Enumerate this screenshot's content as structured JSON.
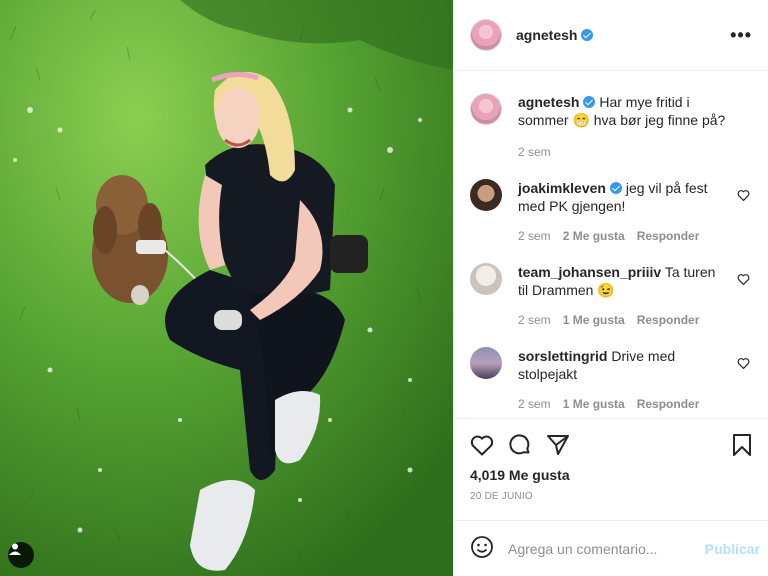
{
  "post": {
    "author": "agnetesh",
    "caption": "Har mye fritid i sommer 😁 hva bør jeg finne på?",
    "caption_time": "2 sem",
    "likes": "4,019 Me gusta",
    "date": "20 DE JUNIO"
  },
  "header": {
    "username": "agnetesh",
    "more_label": "•••"
  },
  "comments": [
    {
      "user": "joakimkleven",
      "verified": true,
      "text": "jeg vil på fest med PK gjengen!",
      "time": "2 sem",
      "likes": "2 Me gusta",
      "reply": "Responder"
    },
    {
      "user": "team_johansen_priiiv",
      "verified": false,
      "text": "Ta turen til Drammen 😉",
      "time": "2 sem",
      "likes": "1 Me gusta",
      "reply": "Responder"
    },
    {
      "user": "sorslettingrid",
      "verified": false,
      "text": "Drive med stolpejakt",
      "time": "2 sem",
      "likes": "1 Me gusta",
      "reply": "Responder"
    }
  ],
  "add_comment": {
    "placeholder": "Agrega un comentario...",
    "publish": "Publicar"
  },
  "icons": {
    "like": "heart-icon",
    "comment": "comment-icon",
    "share": "share-icon",
    "save": "bookmark-icon",
    "emoji": "emoji-icon",
    "tag": "user-tag-icon"
  },
  "colors": {
    "verified": "#3897f0",
    "publish": "#b2dffc",
    "muted": "#8e8e8e"
  }
}
